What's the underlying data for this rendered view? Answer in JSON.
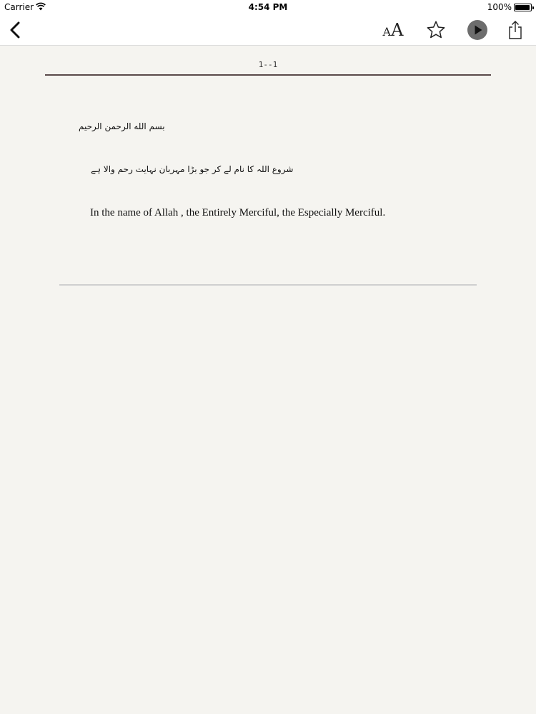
{
  "status_bar": {
    "carrier": "Carrier",
    "time": "4:54 PM",
    "battery": "100%",
    "icons": [
      "wifi-icon",
      "battery-icon"
    ]
  },
  "nav_bar": {
    "font_size_small": "A",
    "font_size_large": "A",
    "icons": [
      "back-chevron-icon",
      "font-size-icon",
      "star-icon",
      "play-icon",
      "share-icon"
    ]
  },
  "page": {
    "page_number": "1--1"
  },
  "verse": {
    "bismillah": "بسم الله الرحمن الرحيم",
    "urdu": "شروع اللہ کا نام لے کر جو بڑا مہربان نہایت رحم والا ہے",
    "english": "In the name of Allah , the Entirely Merciful, the Especially Merciful."
  },
  "colors": {
    "background": "#f5f4f0",
    "bar": "#ffffff",
    "page_rule": "#5a4a4a",
    "section_rule": "#cfcfcf",
    "play_circle": "#6d6d6d"
  }
}
